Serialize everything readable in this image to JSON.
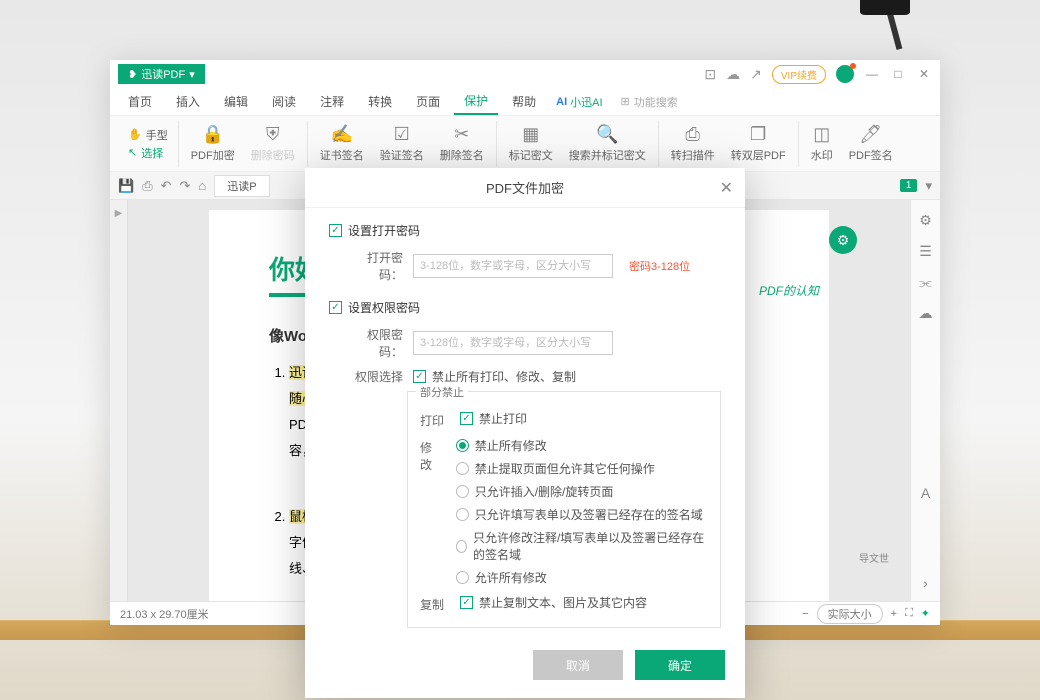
{
  "app": {
    "name": "迅读PDF",
    "dropdown": "▾"
  },
  "titlebar": {
    "vip": "VIP续费",
    "minimize": "—",
    "maximize": "□",
    "close": "✕"
  },
  "menu": {
    "items": [
      "首页",
      "插入",
      "编辑",
      "阅读",
      "注释",
      "转换",
      "页面",
      "保护",
      "帮助"
    ],
    "active_index": 7,
    "ai": "小迅AI",
    "search_placeholder": "功能搜索"
  },
  "toolbar": {
    "hand": "手型",
    "select": "选择",
    "encrypt": "PDF加密",
    "remove_pwd": "删除密码",
    "cert_sign": "证书签名",
    "verify_sign": "验证签名",
    "del_sign": "删除签名",
    "mark_secret": "标记密文",
    "search_mark": "搜索并标记密文",
    "scan_convert": "转扫描件",
    "double_layer": "转双层PDF",
    "watermark": "水印",
    "pdf_sign": "PDF签名"
  },
  "subbar": {
    "doc_tab": "迅读P",
    "page_badge": "1"
  },
  "doc": {
    "title": "你好，欢",
    "right_note": "PDF的认知",
    "h2": "像Word一",
    "list1_a": "迅读PDF提",
    "list1_b": "随心所欲地",
    "list1_c": "PDF，即可",
    "list1_d": "容，我们强",
    "list2_a": "鼠标点击文",
    "list2_b": "字体、大小",
    "list2_c": "线、上下脚",
    "side_text": "导文世"
  },
  "statusbar": {
    "size": "21.03 x 29.70厘米",
    "zoom": "实际大小"
  },
  "modal": {
    "title": "PDF文件加密",
    "open_pwd_section": "设置打开密码",
    "open_pwd_label": "打开密码：",
    "pwd_placeholder": "3-128位，数字或字母，区分大小写",
    "pwd_hint": "密码3-128位",
    "perm_pwd_section": "设置权限密码",
    "perm_pwd_label": "权限密码：",
    "perm_select_label": "权限选择",
    "forbid_all": "禁止所有打印、修改、复制",
    "partial_forbid": "部分禁止",
    "print_label": "打印",
    "print_forbid": "禁止打印",
    "modify_label": "修改",
    "modify_opts": [
      "禁止所有修改",
      "禁止提取页面但允许其它任何操作",
      "只允许插入/删除/旋转页面",
      "只允许填写表单以及签署已经存在的签名域",
      "只允许修改注释/填写表单以及签署已经存在的签名域",
      "允许所有修改"
    ],
    "modify_checked_index": 0,
    "copy_label": "复制",
    "copy_forbid": "禁止复制文本、图片及其它内容",
    "cancel": "取消",
    "ok": "确定"
  }
}
